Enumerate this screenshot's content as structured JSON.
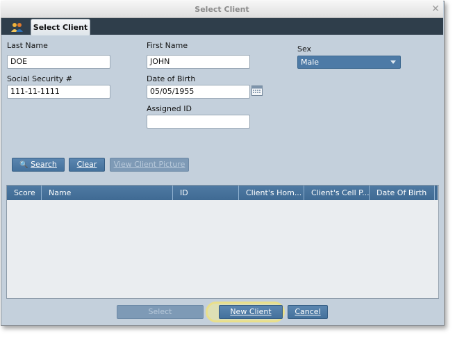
{
  "window": {
    "title": "Select Client",
    "tab_label": "Select Client"
  },
  "form": {
    "last_name_label": "Last Name",
    "last_name_value": "DOE",
    "first_name_label": "First Name",
    "first_name_value": "JOHN",
    "sex_label": "Sex",
    "sex_value": "Male",
    "ssn_label": "Social Security #",
    "ssn_value": "111-11-1111",
    "dob_label": "Date of Birth",
    "dob_value": "05/05/1955",
    "assigned_id_label": "Assigned ID",
    "assigned_id_value": ""
  },
  "actions": {
    "search_label": "Search",
    "clear_label": "Clear",
    "view_picture_label": "View Client Picture"
  },
  "results": {
    "columns": [
      "Score",
      "Name",
      "ID",
      "Client's Hom...",
      "Client's Cell P...",
      "Date Of Birth"
    ],
    "rows": []
  },
  "footer": {
    "select_label": "Select",
    "new_client_label": "New Client",
    "cancel_label": "Cancel"
  },
  "colors": {
    "window_bg": "#c4d0dc",
    "tabstrip_bg": "#2f3e4b",
    "button_blue": "#4d7aa6",
    "highlight": "#e9df8a"
  }
}
